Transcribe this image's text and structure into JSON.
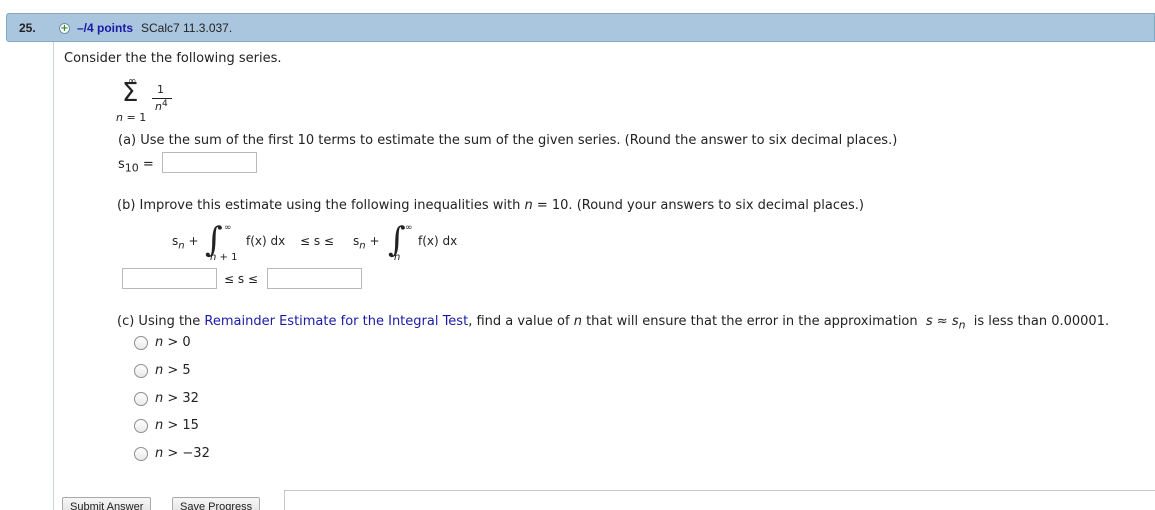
{
  "header": {
    "number": "25.",
    "points": "–/4 points",
    "problem_id": "SCalc7 11.3.037."
  },
  "intro": "Consider the the following series.",
  "series": {
    "upper": "∞",
    "lower": "n = 1",
    "numerator": "1",
    "denominator_base": "n",
    "denominator_exp": "4"
  },
  "part_a": {
    "prompt": "(a) Use the sum of the first 10 terms to estimate the sum of the given series. (Round the answer to six decimal places.)",
    "label_s": "s",
    "label_sub": "10",
    "label_eq": "=",
    "value": ""
  },
  "part_b": {
    "prompt_before": "(b) Improve this estimate using the following inequalities with",
    "prompt_var": "n",
    "prompt_after": "= 10. (Round your answers to six decimal places.)",
    "sn": "s",
    "sn_sub": "n",
    "plus": "+",
    "integral_sign": "∫",
    "int1_upper": "∞",
    "int1_lower": "n + 1",
    "int2_upper": "∞",
    "int2_lower": "n",
    "integrand": "f(x) dx",
    "middle": "≤  s  ≤",
    "lower_value": "",
    "upper_value": "",
    "between": "≤ s ≤"
  },
  "part_c": {
    "prompt_before": "(c) Using the",
    "link_text": "Remainder Estimate for the Integral Test",
    "prompt_mid": ", find a value of",
    "prompt_var": "n",
    "prompt_after": "that will ensure that the error in the approximation",
    "approx": "s ≈ s",
    "approx_sub": "n",
    "prompt_end": "is less than 0.00001.",
    "options": [
      "n > 0",
      "n > 5",
      "n > 32",
      "n > 15",
      "n > −32"
    ]
  },
  "buttons": {
    "submit": "Submit Answer",
    "save": "Save Progress"
  }
}
